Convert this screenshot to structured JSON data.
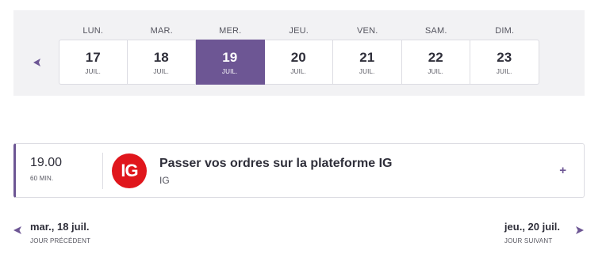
{
  "week": {
    "prev_icon": "chevron-left-icon",
    "accent_color": "#6d5694",
    "days": [
      {
        "dow": "LUN.",
        "num": "17",
        "mon": "JUIL.",
        "selected": false
      },
      {
        "dow": "MAR.",
        "num": "18",
        "mon": "JUIL.",
        "selected": false
      },
      {
        "dow": "MER.",
        "num": "19",
        "mon": "JUIL.",
        "selected": true
      },
      {
        "dow": "JEU.",
        "num": "20",
        "mon": "JUIL.",
        "selected": false
      },
      {
        "dow": "VEN.",
        "num": "21",
        "mon": "JUIL.",
        "selected": false
      },
      {
        "dow": "SAM.",
        "num": "22",
        "mon": "JUIL.",
        "selected": false
      },
      {
        "dow": "DIM.",
        "num": "23",
        "mon": "JUIL.",
        "selected": false
      }
    ]
  },
  "event": {
    "time": "19.00",
    "duration": "60 MIN.",
    "logo_text": "IG",
    "logo_color": "#e0161c",
    "title": "Passer vos ordres sur la plateforme IG",
    "organizer": "IG",
    "expand_label": "+"
  },
  "nav": {
    "prev": {
      "date": "mar., 18 juil.",
      "label": "JOUR PRÉCÉDENT",
      "icon": "chevron-left-icon"
    },
    "next": {
      "date": "jeu., 20 juil.",
      "label": "JOUR SUIVANT",
      "icon": "chevron-right-icon"
    }
  }
}
